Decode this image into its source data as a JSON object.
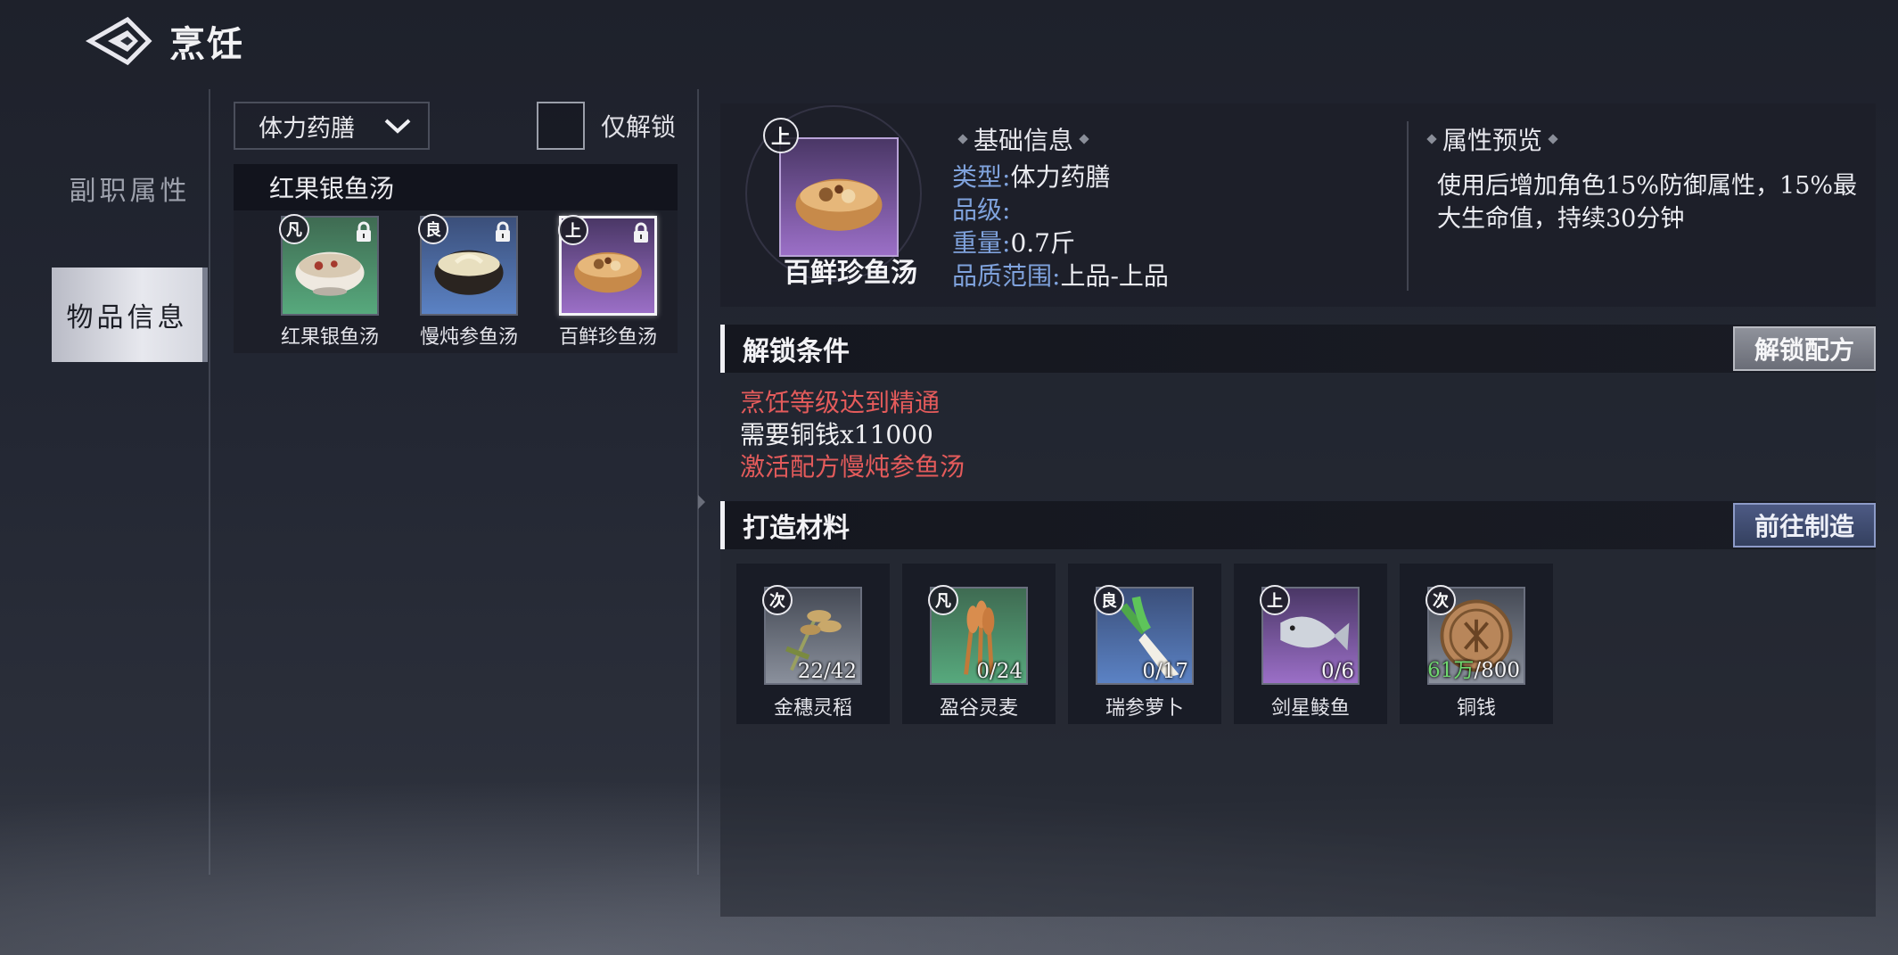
{
  "header": {
    "title": "烹饪",
    "back_icon": "diamond-back-icon"
  },
  "sidebar": {
    "tabs": [
      {
        "label": "副职属性",
        "active": false
      },
      {
        "label": "物品信息",
        "active": true
      }
    ]
  },
  "filter": {
    "selected": "体力药膳",
    "unlock_only_label": "仅解锁",
    "unlock_only_checked": false
  },
  "recipe_group": {
    "title": "红果银鱼汤",
    "items": [
      {
        "grade": "凡",
        "name": "红果银鱼汤",
        "locked": true,
        "quality": "green"
      },
      {
        "grade": "良",
        "name": "慢炖参鱼汤",
        "locked": true,
        "quality": "blue"
      },
      {
        "grade": "上",
        "name": "百鲜珍鱼汤",
        "locked": true,
        "quality": "purple",
        "selected": true
      }
    ]
  },
  "detail": {
    "grade": "上",
    "name": "百鲜珍鱼汤",
    "basic_title": "基础信息",
    "type_label": "类型:",
    "type_value": "体力药膳",
    "level_label": "品级:",
    "level_value": "",
    "weight_label": "重量:",
    "weight_value": "0.7斤",
    "range_label": "品质范围:",
    "range_value": "上品-上品",
    "attr_title": "属性预览",
    "attr_text": "使用后增加角色15%防御属性，15%最大生命值，持续30分钟"
  },
  "unlock": {
    "title": "解锁条件",
    "button": "解锁配方",
    "conditions": [
      {
        "text": "烹饪等级达到精通",
        "met": false
      },
      {
        "text": "需要铜钱x11000",
        "met": true
      },
      {
        "text": "激活配方慢炖参鱼汤",
        "met": false
      }
    ]
  },
  "craft": {
    "title": "打造材料",
    "button": "前往制造",
    "materials": [
      {
        "grade": "次",
        "name": "金穗灵稻",
        "have": "22",
        "need": "42",
        "quality": "gray"
      },
      {
        "grade": "凡",
        "name": "盈谷灵麦",
        "have": "0",
        "need": "24",
        "quality": "green"
      },
      {
        "grade": "良",
        "name": "瑞参萝卜",
        "have": "0",
        "need": "17",
        "quality": "blue"
      },
      {
        "grade": "上",
        "name": "剑星鲮鱼",
        "have": "0",
        "need": "6",
        "quality": "purple"
      },
      {
        "grade": "次",
        "name": "铜钱",
        "have": "61万",
        "need": "800",
        "quality": "gray"
      }
    ]
  },
  "colors": {
    "accent_red": "#e45b5b",
    "key_blue": "#7fa2dc",
    "have_green": "#6fd86f"
  }
}
